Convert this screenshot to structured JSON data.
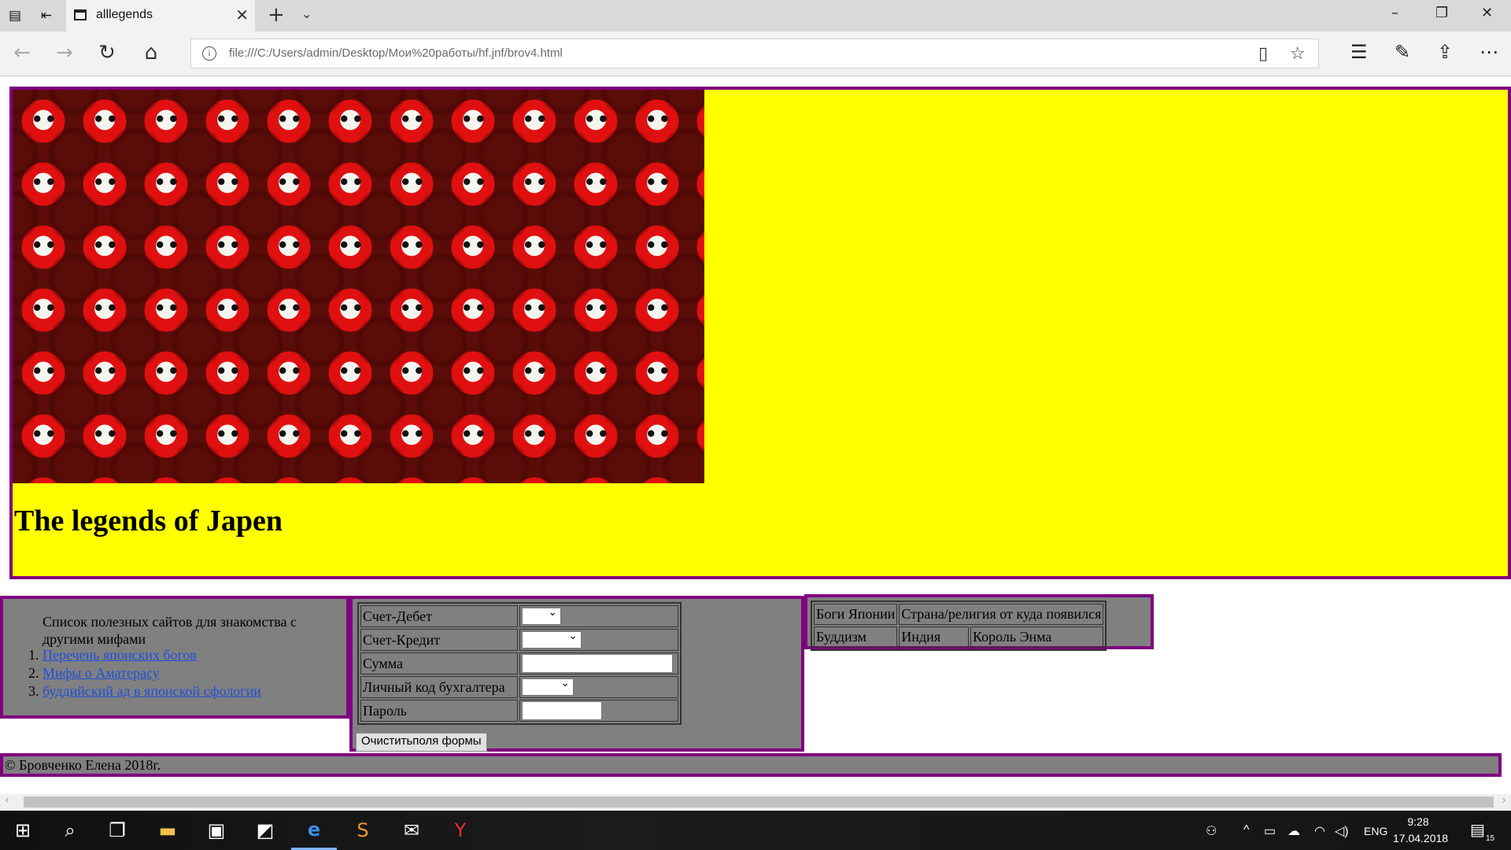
{
  "browser": {
    "tab_title": "alllegends",
    "url": "file:///C:/Users/admin/Desktop/Мои%20работы/hf.jnf/brov4.html"
  },
  "header": {
    "title": "The legends of Japen"
  },
  "sidebar": {
    "caption": "Список полезных сайтов для знакомства с другими мифами",
    "links": [
      {
        "label": "Перечень японских богов"
      },
      {
        "label": "Мифы о Аматерасу"
      },
      {
        "label": "буддийский ад в японской сфологии"
      }
    ]
  },
  "form": {
    "rows": [
      {
        "label": "Счет-Дебет"
      },
      {
        "label": "Счет-Кредит"
      },
      {
        "label": "Сумма"
      },
      {
        "label": "Личный код бухгалтера"
      },
      {
        "label": "Пароль"
      }
    ],
    "reset_label": "Очиститьполя формы"
  },
  "gods_table": {
    "header": [
      "Боги Японии",
      "Страна/религия от куда появился"
    ],
    "row": [
      "Буддизм",
      "Индия",
      "Король Энма"
    ]
  },
  "footer": {
    "text": "© Бровченко Елена 2018г."
  },
  "taskbar": {
    "language": "ENG",
    "time": "9:28",
    "date": "17.04.2018",
    "notification_count": "15"
  },
  "colors": {
    "header_bg": "#ffff00",
    "panel_bg": "#808080",
    "border": "#800080",
    "link": "#1f4fd8"
  }
}
